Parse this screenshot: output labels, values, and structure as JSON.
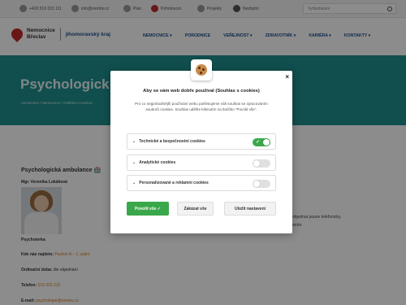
{
  "topbar": {
    "phone": "+420 519 315 111",
    "email": "info@nembv.cz",
    "items": [
      "Plán",
      "Pohotovost",
      "Projekty",
      "Nezbytní"
    ],
    "search_placeholder": "Vyhledávání"
  },
  "header": {
    "logo_line1": "Nemocnice",
    "logo_line2": "Břeclav",
    "region": "jihomoravský kraj",
    "nav": [
      "NEMOCNICE ▾",
      "PORODNICE",
      "VEŘEJNOST ▾",
      "ZDRAVOTNÍK ▾",
      "KARIÉRA ▾",
      "KONTAKTY ▾"
    ]
  },
  "hero": {
    "title": "Psychologick",
    "breadcrumb": "nemocnice / Nemocnice / Oddělení a ambul..."
  },
  "content": {
    "title": "Psychologická ambulance 🏥",
    "person": "Mgr. Veronika Lokáková",
    "role": "Psychoterka",
    "location_label": "Kde nás najdete:",
    "location_value": "Pavilon A – 1. patro",
    "hours_label": "Ordinační doba:",
    "hours_value": "dle objednání",
    "phone_label": "Telefon:",
    "phone_value": "519 315 310",
    "email_label": "E-mail:",
    "email_value": "psychologie@nembv.cz",
    "side_line1": "objednat pouze telefonicky.",
    "side_line2": "ením."
  },
  "cookie_modal": {
    "title": "Aby se vám web dobře používal (Souhlas s cookies)",
    "description": "Pro co nejpohodlnější používání webu potřebujeme váš souhlas se zpracováním souborů cookies. Souhlas udělíte kliknutím na tlačítko \"Povolit vše\".",
    "categories": [
      {
        "label": "Technické a bezpečnostní cookies",
        "enabled": true
      },
      {
        "label": "Analytické cookies",
        "enabled": false
      },
      {
        "label": "Personalizované a reklamní cookies",
        "enabled": false
      }
    ],
    "accept_label": "Povolit vše ✓",
    "reject_label": "Zakázat vše",
    "save_label": "Uložit nastavení",
    "close_label": "×",
    "accent_color": "#3aa84a"
  }
}
